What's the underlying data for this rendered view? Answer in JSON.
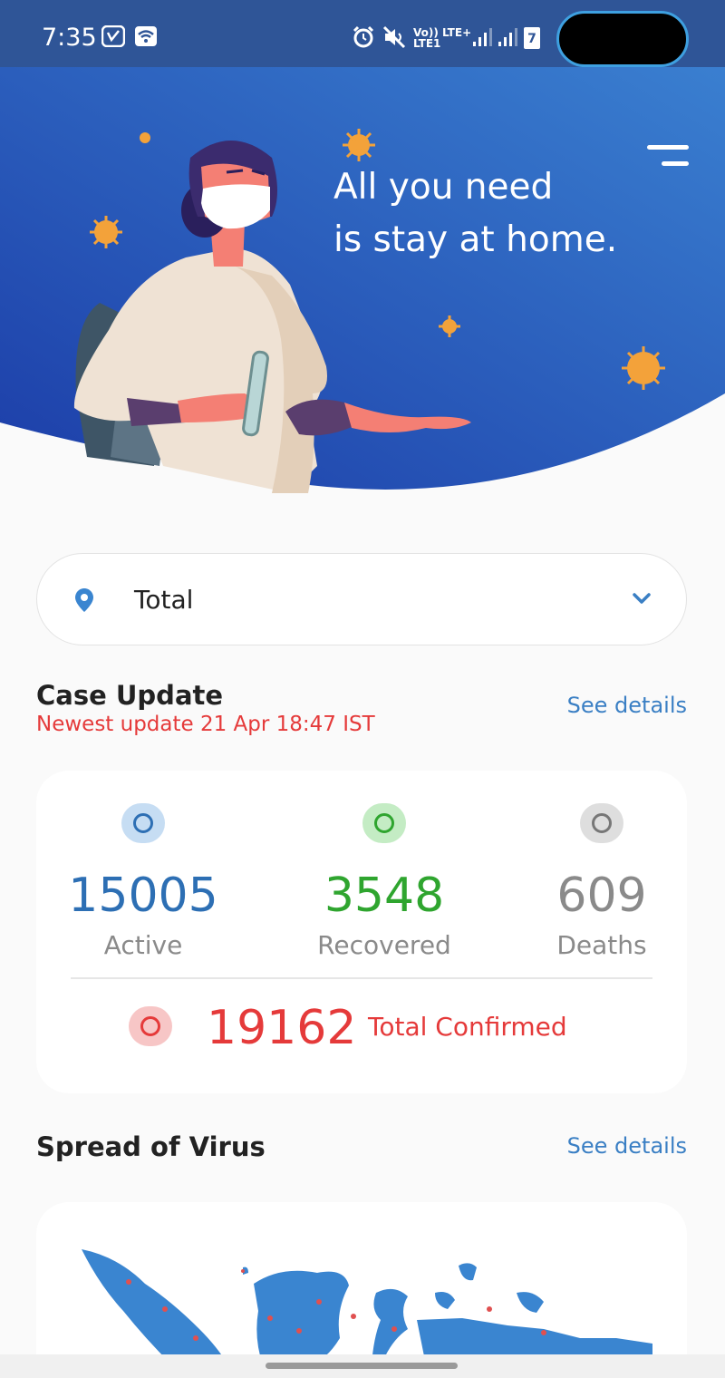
{
  "status_bar": {
    "time": "7:35",
    "network_text_top": "Vo)) LTE+",
    "network_text_bottom": "LTE1",
    "battery_level": "7",
    "icons": [
      "saavn-icon",
      "wifi-icon",
      "alarm-icon",
      "mute-icon",
      "signal-icon",
      "signal-icon",
      "battery-icon"
    ]
  },
  "hero": {
    "line1": "All you need",
    "line2": "is stay at home.",
    "gradient_start": "#1c3da8",
    "gradient_end": "#3a7fd0"
  },
  "location": {
    "selected": "Total",
    "icon": "location-pin-icon",
    "dropdown_icon": "chevron-down-icon"
  },
  "case_update": {
    "title": "Case Update",
    "subtitle": "Newest update 21 Apr 18:47 IST",
    "see_details": "See details",
    "stats": [
      {
        "value": "15005",
        "label": "Active",
        "color": "#2d6fb4"
      },
      {
        "value": "3548",
        "label": "Recovered",
        "color": "#2fa52f"
      },
      {
        "value": "609",
        "label": "Deaths",
        "color": "#8a8a8a"
      }
    ],
    "total": {
      "value": "19162",
      "label": "Total Confirmed",
      "color": "#e53a3a"
    }
  },
  "spread": {
    "title": "Spread of Virus",
    "see_details": "See details",
    "map_color": "#3a85d0",
    "marker_color": "#e05050"
  }
}
